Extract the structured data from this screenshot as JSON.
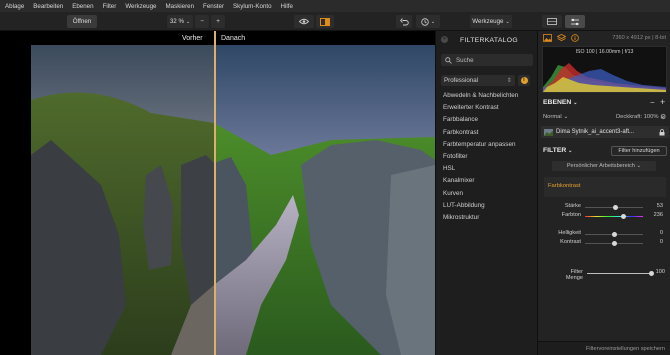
{
  "menu": [
    "Ablage",
    "Bearbeiten",
    "Ebenen",
    "Filter",
    "Werkzeuge",
    "Maskieren",
    "Fenster",
    "Skylum-Konto",
    "Hilfe"
  ],
  "toolbar": {
    "open_label": "Öffnen",
    "zoom_value": "32 %",
    "zoom_minus": "−",
    "zoom_plus": "+",
    "tools_label": "Werkzeuge"
  },
  "canvas": {
    "before_label": "Vorher",
    "after_label": "Danach",
    "split_position": 0.535
  },
  "catalog": {
    "title": "FILTERKATALOG",
    "search_placeholder": "Suche",
    "mode": "Professional",
    "filters": [
      "Abwedeln & Nachbelichten",
      "Erweiterter Kontrast",
      "Farbbalance",
      "Farbkontrast",
      "Farbtemperatur anpassen",
      "Fotofilter",
      "HSL",
      "Kanalmixer",
      "Kurven",
      "LUT-Abbildung",
      "Mikrostruktur"
    ]
  },
  "right_panel": {
    "image_info": "7360 x 4912 px  |  8-bit",
    "exif": "ISO 100  |  16.00mm  |  f/13",
    "layers_title": "EBENEN",
    "blend_mode": "Normal",
    "opacity_label": "Deckkraft: 100%",
    "layer_name": "Dima Sytnik_ai_accent3-aft...",
    "filter_title": "FILTER",
    "add_filter": "Filter hinzufügen",
    "workspace": "Persönlicher Arbeitsbereich",
    "active_filter": "Farbkontrast",
    "sliders": [
      {
        "label": "Stärke",
        "value": "53",
        "fraction": 0.53
      },
      {
        "label": "Farbton",
        "value": "236",
        "fraction": 0.66
      },
      {
        "label": "Helligkeit",
        "value": "0",
        "fraction": 0.5
      },
      {
        "label": "Kontrast",
        "value": "0",
        "fraction": 0.5
      }
    ],
    "amount": {
      "label": "Filter Menge",
      "value": "100",
      "fraction": 1.0
    },
    "footer": "Filtervoreinstellungen speichern"
  },
  "colors": {
    "accent": "#e08a1c",
    "divider": "#d9b070"
  }
}
